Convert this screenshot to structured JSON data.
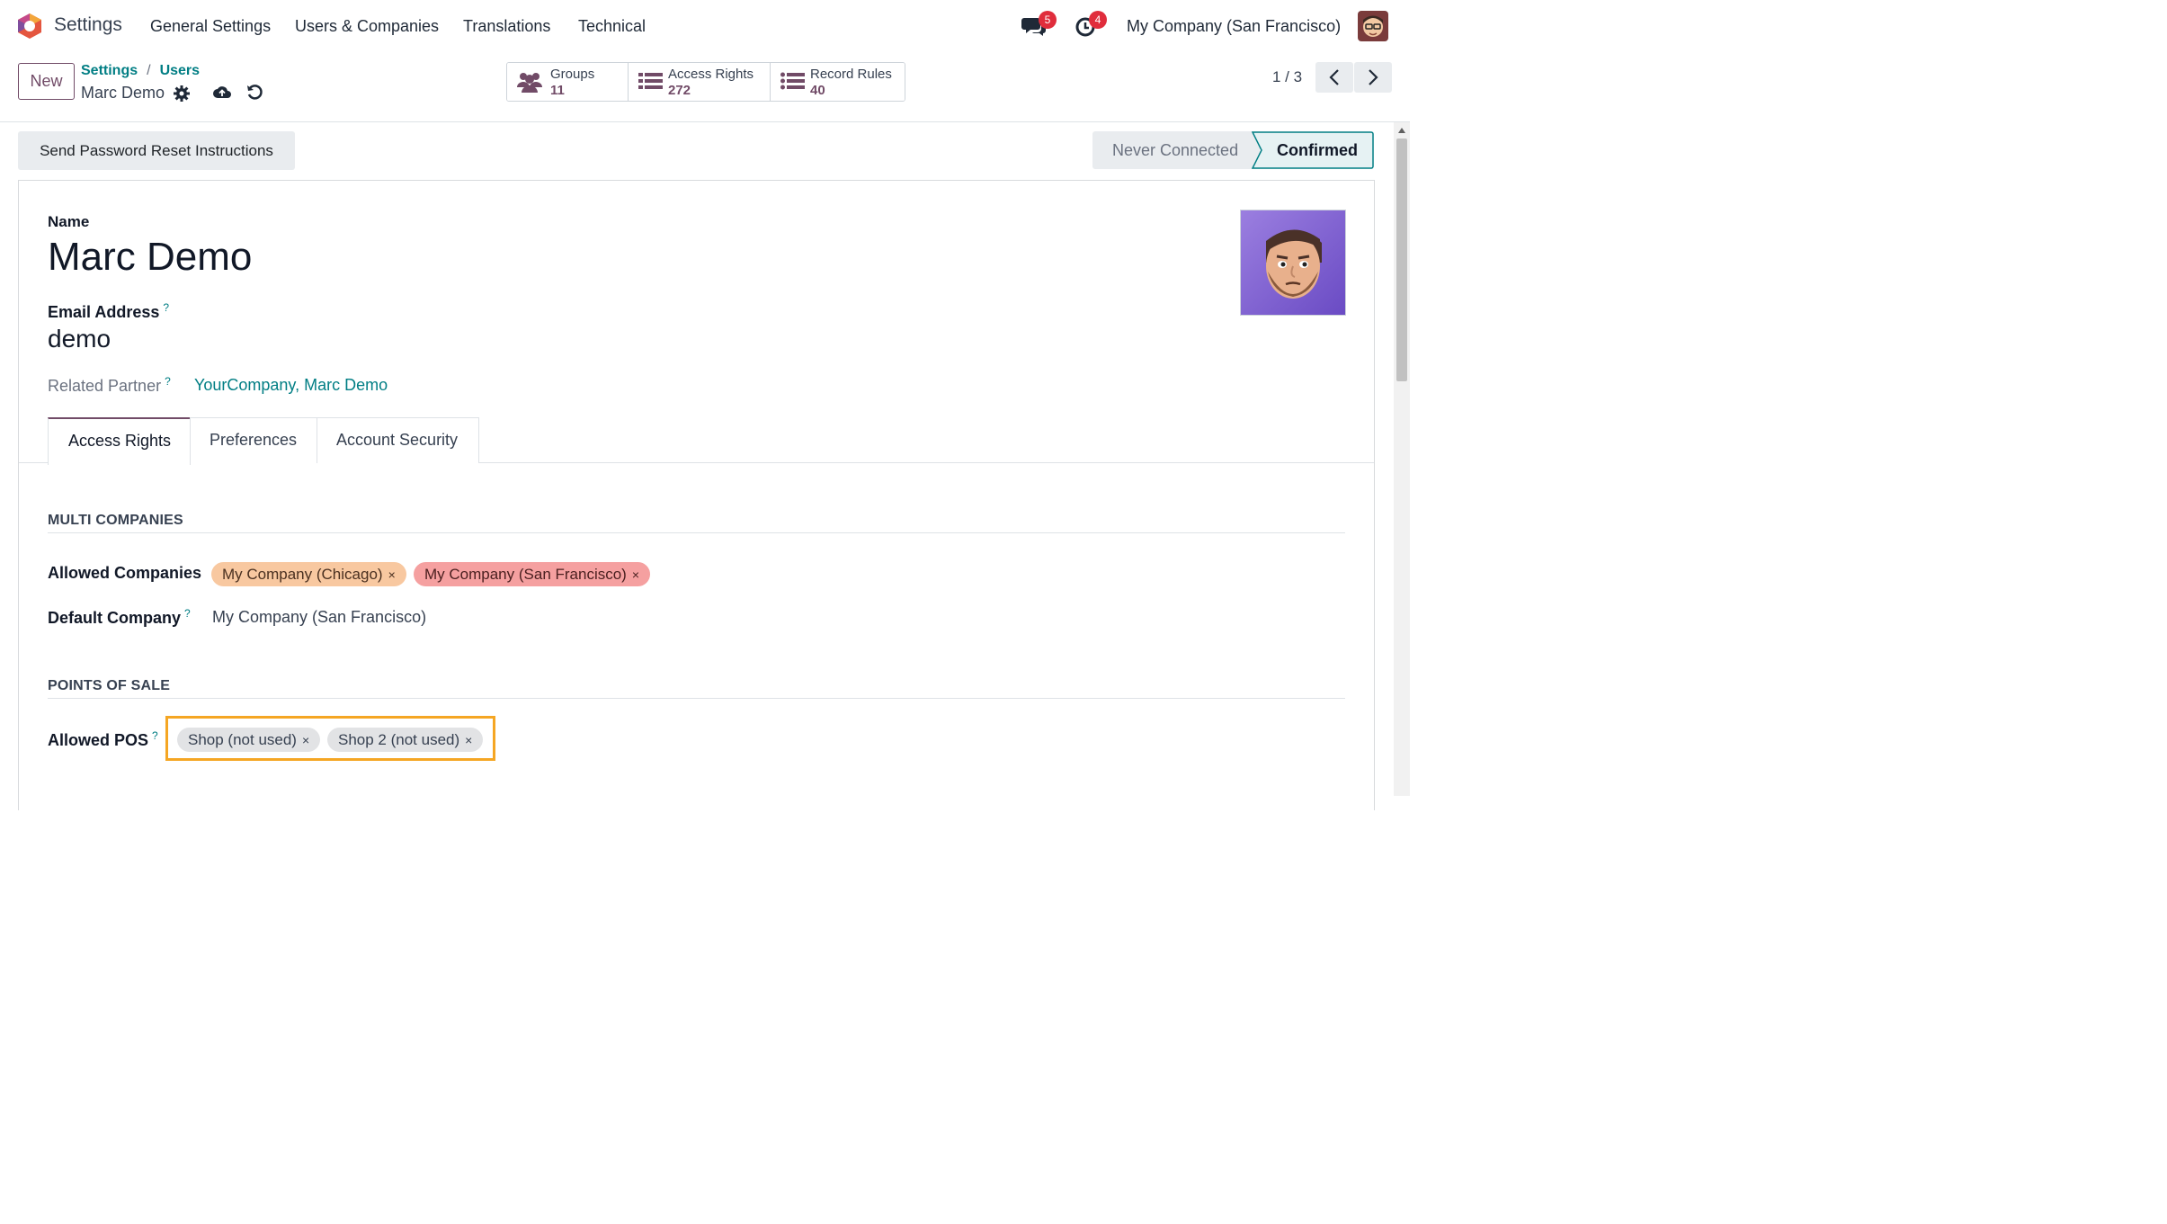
{
  "navbar": {
    "app_name": "Settings",
    "menus": [
      "General Settings",
      "Users & Companies",
      "Translations",
      "Technical"
    ],
    "messages_badge": "5",
    "activities_badge": "4",
    "company": "My Company (San Francisco)"
  },
  "control_panel": {
    "new_label": "New",
    "breadcrumb": [
      "Settings",
      "Users"
    ],
    "breadcrumb_sep": "/",
    "current_record": "Marc Demo",
    "smart_buttons": [
      {
        "label": "Groups",
        "value": "11",
        "icon": "users-icon"
      },
      {
        "label": "Access Rights",
        "value": "272",
        "icon": "list-icon"
      },
      {
        "label": "Record Rules",
        "value": "40",
        "icon": "list-icon"
      }
    ],
    "pager": "1 / 3"
  },
  "statusbar": {
    "reset_button": "Send Password Reset Instructions",
    "stages": [
      "Never Connected",
      "Confirmed"
    ],
    "active_stage": "Confirmed"
  },
  "form": {
    "name_label": "Name",
    "name_value": "Marc Demo",
    "email_label": "Email Address",
    "email_value": "demo",
    "help_mark": "?",
    "partner_label": "Related Partner",
    "partner_value": "YourCompany, Marc Demo",
    "tabs": [
      "Access Rights",
      "Preferences",
      "Account Security"
    ],
    "active_tab": "Access Rights",
    "multi_companies": {
      "title": "MULTI COMPANIES",
      "allowed_label": "Allowed Companies",
      "allowed": [
        {
          "name": "My Company (Chicago)",
          "color": "#f8c8a0"
        },
        {
          "name": "My Company (San Francisco)",
          "color": "#f5a0a0"
        }
      ],
      "default_label": "Default Company",
      "default_value": "My Company (San Francisco)"
    },
    "points_of_sale": {
      "title": "POINTS OF SALE",
      "allowed_label": "Allowed POS",
      "allowed": [
        "Shop (not used)",
        "Shop 2 (not used)"
      ]
    }
  },
  "colors": {
    "brand": "#714b67",
    "link": "#017e84",
    "highlight": "#f5a623"
  }
}
